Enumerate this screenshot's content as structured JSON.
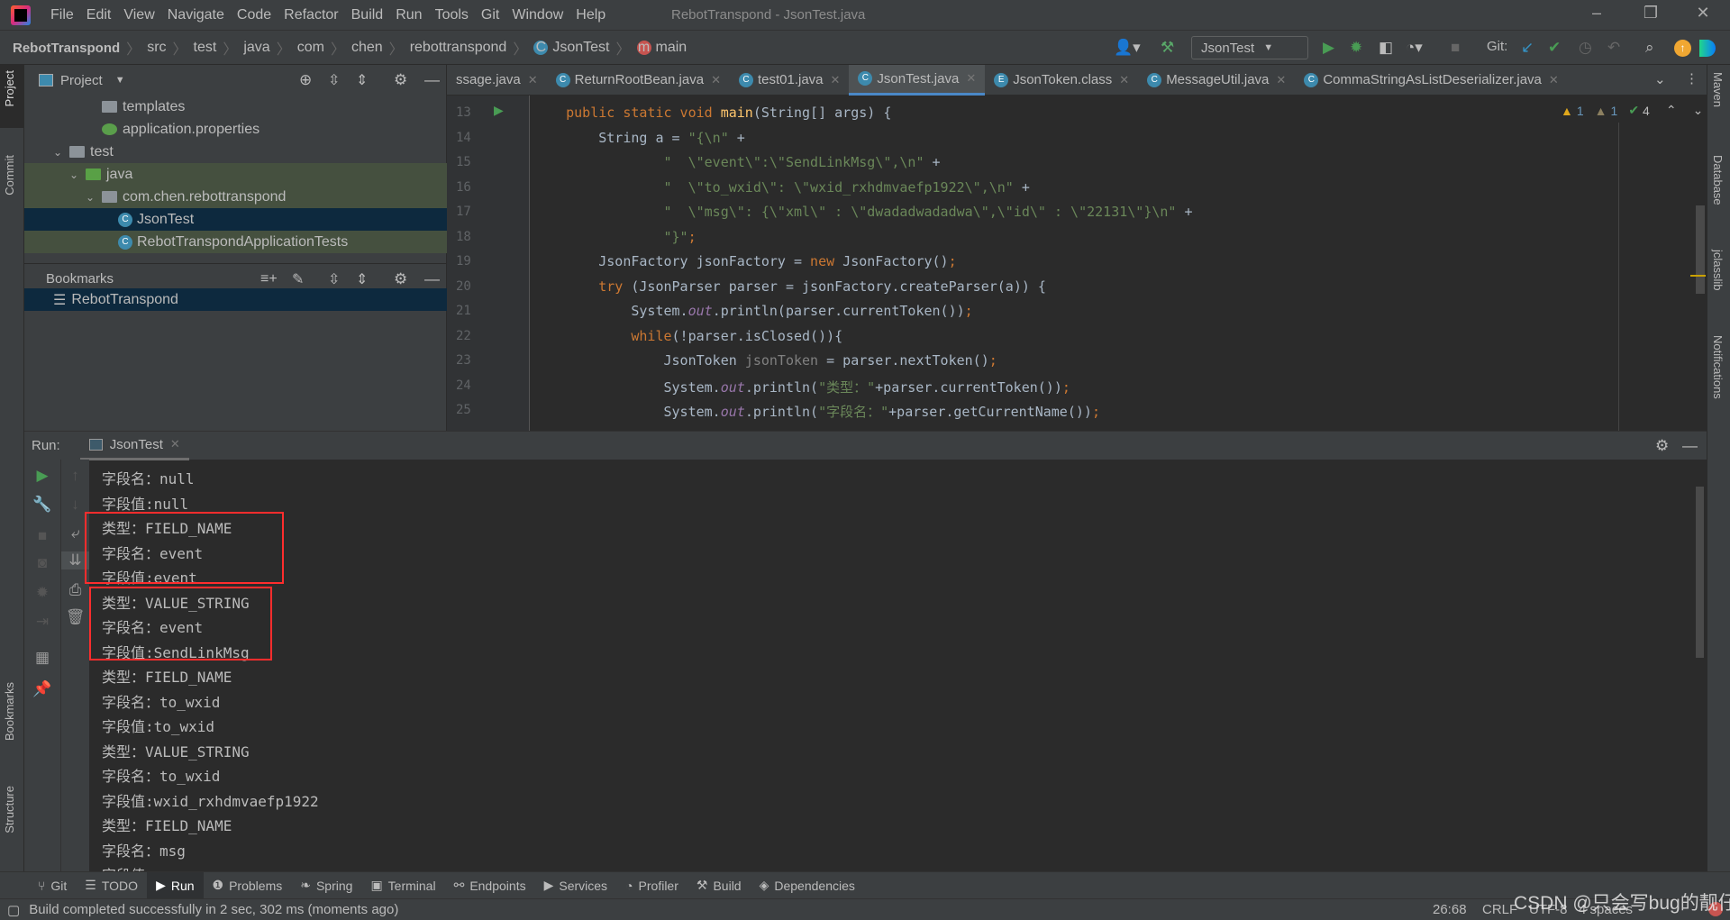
{
  "window": {
    "title": "RebotTranspond - JsonTest.java",
    "menu": [
      "File",
      "Edit",
      "View",
      "Navigate",
      "Code",
      "Refactor",
      "Build",
      "Run",
      "Tools",
      "Git",
      "Window",
      "Help"
    ]
  },
  "breadcrumb": [
    "RebotTranspond",
    "src",
    "test",
    "java",
    "com",
    "chen",
    "rebottranspond",
    "JsonTest",
    "main"
  ],
  "toolbar": {
    "run_config": "JsonTest",
    "git_label": "Git:"
  },
  "left_strip": [
    "Project",
    "Commit",
    "Bookmarks",
    "Structure"
  ],
  "right_strip": [
    "Maven",
    "Database",
    "jclasslib",
    "Notifications"
  ],
  "project": {
    "title": "Project",
    "tree": [
      {
        "label": "templates",
        "type": "folder",
        "depth": 5
      },
      {
        "label": "application.properties",
        "type": "props",
        "depth": 5
      },
      {
        "label": "test",
        "type": "folder",
        "depth": 3,
        "expanded": true
      },
      {
        "label": "java",
        "type": "src-folder",
        "depth": 4,
        "expanded": true
      },
      {
        "label": "com.chen.rebottranspond",
        "type": "package",
        "depth": 5,
        "expanded": true
      },
      {
        "label": "JsonTest",
        "type": "class",
        "depth": 6,
        "selected": true
      },
      {
        "label": "RebotTranspondApplicationTests",
        "type": "class",
        "depth": 6
      }
    ]
  },
  "bookmarks": {
    "title": "Bookmarks",
    "items": [
      "RebotTranspond"
    ]
  },
  "editor": {
    "tabs": [
      {
        "label": "ssage.java",
        "icon": ""
      },
      {
        "label": "ReturnRootBean.java",
        "icon": "C"
      },
      {
        "label": "test01.java",
        "icon": "C"
      },
      {
        "label": "JsonTest.java",
        "icon": "C",
        "active": true
      },
      {
        "label": "JsonToken.class",
        "icon": "E"
      },
      {
        "label": "MessageUtil.java",
        "icon": "C"
      },
      {
        "label": "CommaStringAsListDeserializer.java",
        "icon": "C"
      }
    ],
    "inspections": {
      "warnings": "1",
      "weak_warnings": "1",
      "typos": "4"
    },
    "lines": [
      {
        "n": "13",
        "t": [
          [
            "    "
          ],
          [
            "public static void ",
            "k"
          ],
          [
            "main",
            "m"
          ],
          [
            "(String[] args) {"
          ]
        ]
      },
      {
        "n": "14",
        "t": [
          [
            "        String a = "
          ],
          [
            "\"{\\n\"",
            "s"
          ],
          [
            " +"
          ]
        ]
      },
      {
        "n": "15",
        "t": [
          [
            "                "
          ],
          [
            "\"  \\\"event\\\":\\\"SendLinkMsg\\\",\\n\"",
            "s"
          ],
          [
            " +"
          ]
        ]
      },
      {
        "n": "16",
        "t": [
          [
            "                "
          ],
          [
            "\"  \\\"to_wxid\\\": \\\"wxid_rxhdmvaefp1922\\\",\\n\"",
            "s"
          ],
          [
            " +"
          ]
        ]
      },
      {
        "n": "17",
        "t": [
          [
            "                "
          ],
          [
            "\"  \\\"msg\\\": {\\\"xml\\\" : \\\"dwadadwadadwa\\\",\\\"id\\\" : \\\"22131\\\"}\\n\"",
            "s"
          ],
          [
            " +"
          ]
        ]
      },
      {
        "n": "18",
        "t": [
          [
            "                "
          ],
          [
            "\"}\"",
            "s"
          ],
          [
            ";",
            "k"
          ]
        ]
      },
      {
        "n": "19",
        "t": [
          [
            "        JsonFactory jsonFactory = "
          ],
          [
            "new ",
            "k"
          ],
          [
            "JsonFactory()"
          ],
          [
            ";",
            "k"
          ]
        ]
      },
      {
        "n": "20",
        "t": [
          [
            "        "
          ],
          [
            "try ",
            "k"
          ],
          [
            "(JsonParser parser = jsonFactory.createParser(a)) {"
          ]
        ]
      },
      {
        "n": "21",
        "t": [
          [
            "            System."
          ],
          [
            "out",
            "f"
          ],
          [
            ".println(parser.currentToken())"
          ],
          [
            ";",
            "k"
          ]
        ]
      },
      {
        "n": "22",
        "t": [
          [
            "            "
          ],
          [
            "while",
            "k"
          ],
          [
            "(!parser.isClosed()){"
          ]
        ]
      },
      {
        "n": "23",
        "t": [
          [
            "                JsonToken "
          ],
          [
            "jsonToken",
            "g"
          ],
          [
            " = parser.nextToken()"
          ],
          [
            ";",
            "k"
          ]
        ]
      },
      {
        "n": "24",
        "t": [
          [
            "                System."
          ],
          [
            "out",
            "f"
          ],
          [
            ".println("
          ],
          [
            "\"类型：\"",
            "s"
          ],
          [
            "+parser.currentToken())"
          ],
          [
            ";",
            "k"
          ]
        ]
      },
      {
        "n": "25",
        "t": [
          [
            "                System."
          ],
          [
            "out",
            "f"
          ],
          [
            ".println("
          ],
          [
            "\"字段名：\"",
            "s"
          ],
          [
            "+parser.getCurrentName())"
          ],
          [
            ";",
            "k"
          ]
        ]
      }
    ]
  },
  "run": {
    "label": "Run:",
    "tab": "JsonTest",
    "output": [
      "字段名：null",
      "字段值:null",
      "类型：FIELD_NAME",
      "字段名：event",
      "字段值:event",
      "类型：VALUE_STRING",
      "字段名：event",
      "字段值:SendLinkMsg",
      "类型：FIELD_NAME",
      "字段名：to_wxid",
      "字段值:to_wxid",
      "类型：VALUE_STRING",
      "字段名：to_wxid",
      "字段值:wxid_rxhdmvaefp1922",
      "类型：FIELD_NAME",
      "字段名：msg",
      "字段值:msg"
    ]
  },
  "bottom_tabs": [
    {
      "label": "Git",
      "icon": "⑂"
    },
    {
      "label": "TODO",
      "icon": "☰"
    },
    {
      "label": "Run",
      "icon": "▶",
      "active": true
    },
    {
      "label": "Problems",
      "icon": "❶"
    },
    {
      "label": "Spring",
      "icon": "❧"
    },
    {
      "label": "Terminal",
      "icon": "▣"
    },
    {
      "label": "Endpoints",
      "icon": "⚯"
    },
    {
      "label": "Services",
      "icon": "▶"
    },
    {
      "label": "Profiler",
      "icon": "◔"
    },
    {
      "label": "Build",
      "icon": "⚒"
    },
    {
      "label": "Dependencies",
      "icon": "◈"
    }
  ],
  "status": {
    "message": "Build completed successfully in 2 sec, 302 ms (moments ago)",
    "position": "26:68",
    "line_sep": "CRLF",
    "encoding": "UTF-8",
    "indent": "4 spaces"
  },
  "watermark": "CSDN @只会写bug的靓仔",
  "colors": {
    "keyword": "#cc7832",
    "string": "#6a8759",
    "highlight_box": "#ff2d2d",
    "accent": "#4a88c7"
  }
}
